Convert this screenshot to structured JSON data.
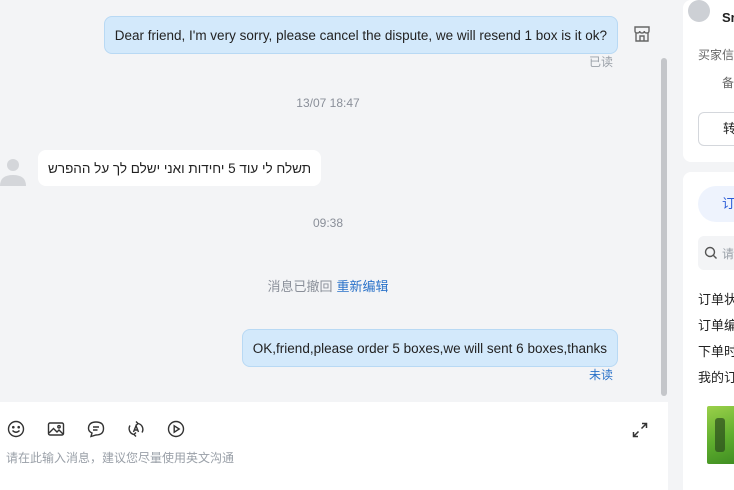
{
  "chat": {
    "messages": [
      {
        "direction": "out",
        "text": "Dear friend, I'm very sorry, please cancel the dispute, we will resend 1 box is it ok?",
        "status": "已读"
      },
      {
        "direction": "stamp",
        "text": "13/07 18:47"
      },
      {
        "direction": "in",
        "text": "תשלח לי עוד 5 יחידות ואני ישלם לך על ההפרש"
      },
      {
        "direction": "stamp",
        "text": "09:38"
      },
      {
        "direction": "system",
        "text": "消息已撤回",
        "action": "重新编辑"
      },
      {
        "direction": "out",
        "text": "OK,friend,please order 5 boxes,we will sent 6 boxes,thanks",
        "status": "未读"
      }
    ],
    "status_colors": {
      "read": "#9aa0a8",
      "unread": "#2a72c9"
    }
  },
  "input": {
    "placeholder": "请在此输入消息，建议您尽量使用英文沟通",
    "tools": [
      "emoji-icon",
      "image-icon",
      "quick-reply-icon",
      "translate-icon",
      "video-icon"
    ],
    "expand_icon": "expand-icon"
  },
  "panel": {
    "name": "Sr",
    "buyer_label": "买家信",
    "note_label": "备",
    "button_label": "转",
    "tab_label": "订",
    "search_placeholder": "请",
    "fields": [
      "订单状",
      "订单编",
      "下单时",
      "我的订"
    ]
  },
  "colors": {
    "bubble_out": "#d3e9fb",
    "accent": "#2a72c9",
    "tab_accent": "#2a5bd7"
  }
}
